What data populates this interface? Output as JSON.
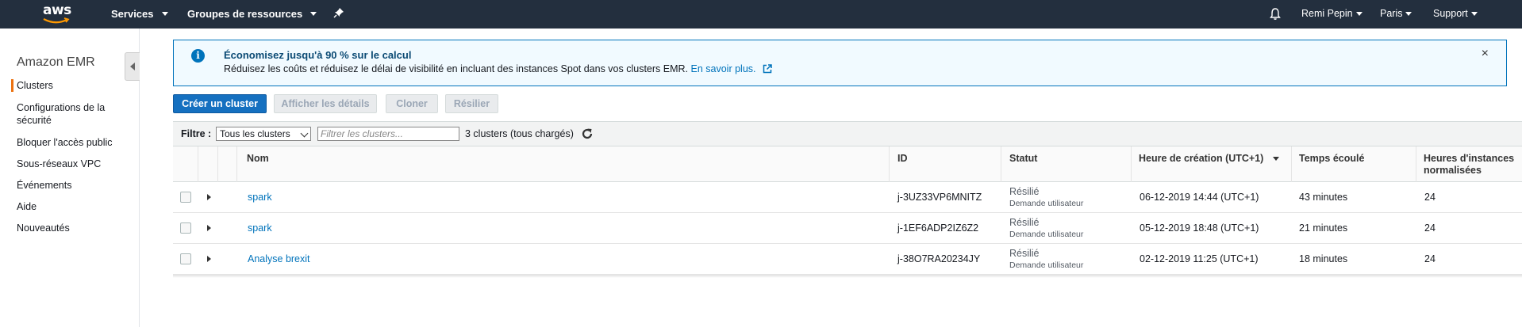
{
  "topnav": {
    "logo_text": "aws",
    "services": "Services",
    "resource_groups": "Groupes de ressources",
    "user": "Remi Pepin",
    "region": "Paris",
    "support": "Support",
    "background": "#232f3e"
  },
  "sidebar": {
    "title": "Amazon EMR",
    "items": [
      {
        "label": "Clusters",
        "active": true
      },
      {
        "label": "Configurations de la sécurité"
      },
      {
        "label": "Bloquer l'accès public"
      },
      {
        "label": "Sous-réseaux VPC"
      },
      {
        "label": "Événements"
      },
      {
        "label": "Aide"
      },
      {
        "label": "Nouveautés"
      }
    ],
    "accent": "#ec7211"
  },
  "alert": {
    "title": "Économisez jusqu'à 90 % sur le calcul",
    "body": "Réduisez les coûts et réduisez le délai de visibilité en incluant des instances Spot dans vos clusters EMR.",
    "link": "En savoir plus.",
    "close": "×",
    "info_glyph": "i"
  },
  "actions": {
    "create": "Créer un cluster",
    "details": "Afficher les détails",
    "clone": "Cloner",
    "terminate": "Résilier"
  },
  "filter": {
    "label": "Filtre :",
    "select_value": "Tous les clusters",
    "placeholder": "Filtrer les clusters...",
    "count": "3 clusters (tous chargés)"
  },
  "table": {
    "columns": {
      "name": "Nom",
      "id": "ID",
      "status": "Statut",
      "created": "Heure de création (UTC+1)",
      "elapsed": "Temps écoulé",
      "hours": "Heures d'instances normalisées"
    },
    "rows": [
      {
        "name": "spark",
        "id": "j-3UZ33VP6MNITZ",
        "status": "Résilié",
        "status_detail": "Demande utilisateur",
        "created": "06-12-2019 14:44 (UTC+1)",
        "elapsed": "43 minutes",
        "hours": "24"
      },
      {
        "name": "spark",
        "id": "j-1EF6ADP2IZ6Z2",
        "status": "Résilié",
        "status_detail": "Demande utilisateur",
        "created": "05-12-2019 18:48 (UTC+1)",
        "elapsed": "21 minutes",
        "hours": "24"
      },
      {
        "name": "Analyse brexit",
        "id": "j-38O7RA20234JY",
        "status": "Résilié",
        "status_detail": "Demande utilisateur",
        "created": "02-12-2019 11:25 (UTC+1)",
        "elapsed": "18 minutes",
        "hours": "24"
      }
    ]
  }
}
